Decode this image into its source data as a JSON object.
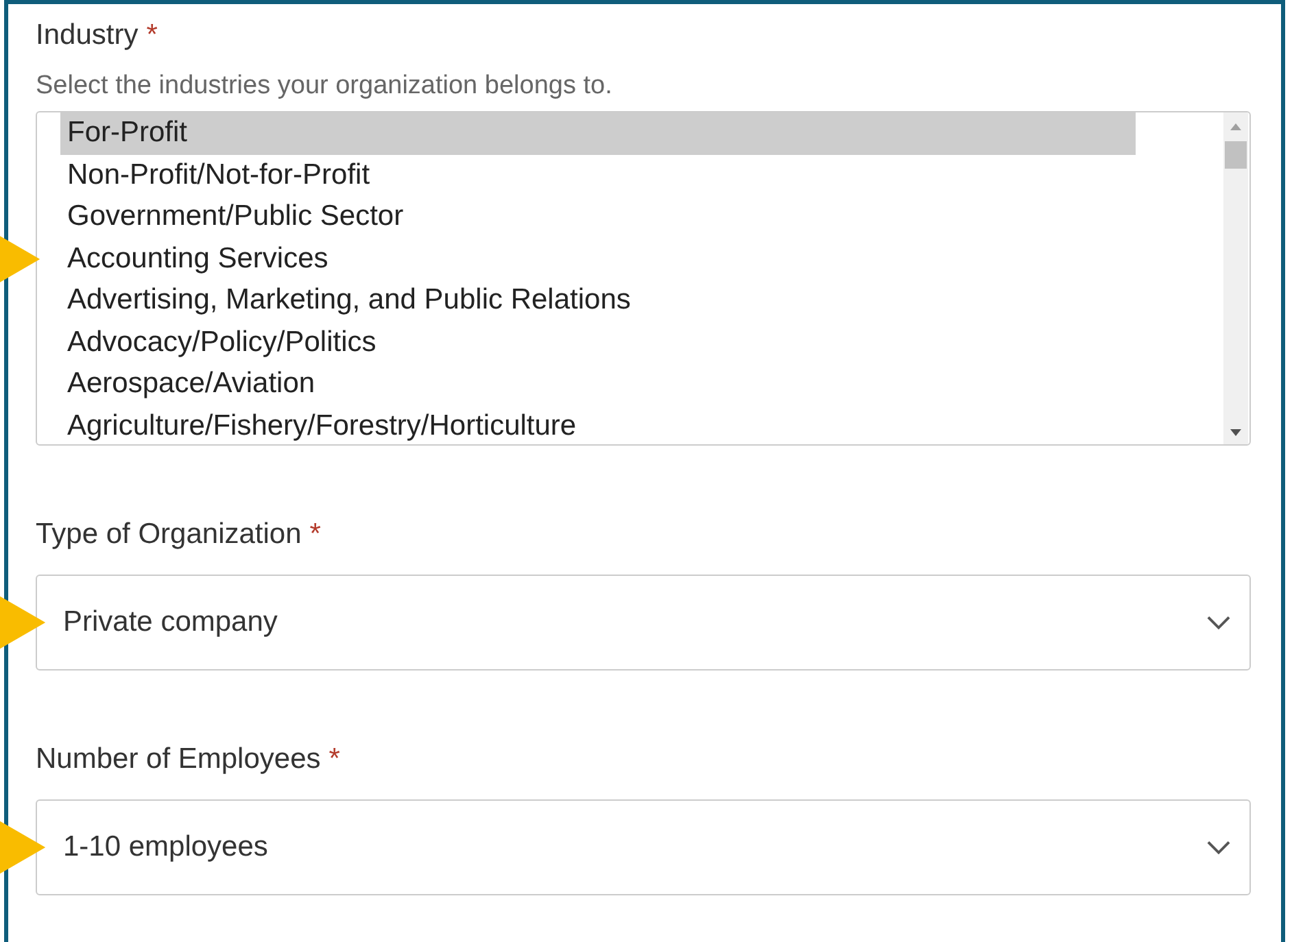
{
  "industry": {
    "label": "Industry",
    "required_mark": "*",
    "hint": "Select the industries your organization belongs to.",
    "options": [
      {
        "label": "For-Profit",
        "selected": true,
        "annotated": false
      },
      {
        "label": "Non-Profit/Not-for-Profit",
        "selected": false,
        "annotated": false
      },
      {
        "label": "Government/Public Sector",
        "selected": false,
        "annotated": false
      },
      {
        "label": "Accounting Services",
        "selected": false,
        "annotated": true
      },
      {
        "label": "Advertising, Marketing, and Public Relations",
        "selected": false,
        "annotated": false
      },
      {
        "label": "Advocacy/Policy/Politics",
        "selected": false,
        "annotated": false
      },
      {
        "label": "Aerospace/Aviation",
        "selected": false,
        "annotated": false
      },
      {
        "label": "Agriculture/Fishery/Forestry/Horticulture",
        "selected": false,
        "annotated": false
      }
    ]
  },
  "selects": [
    {
      "label": "Type of Organization",
      "required_mark": "*",
      "value": "Private company",
      "annotated": true
    },
    {
      "label": "Number of Employees",
      "required_mark": "*",
      "value": "1-10 employees",
      "annotated": true
    }
  ]
}
